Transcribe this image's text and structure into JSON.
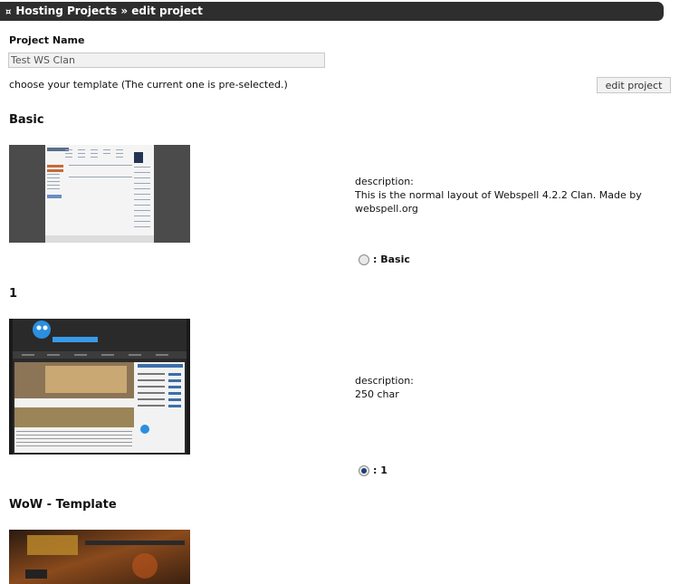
{
  "header": {
    "icon": "hosting-icon",
    "title": "Hosting Projects » edit project"
  },
  "form": {
    "project_name_label": "Project Name",
    "project_name_value": "Test WS Clan",
    "template_hint": "choose your template (The current one is pre-selected.)",
    "submit_label": "edit project"
  },
  "templates": [
    {
      "name": "Basic",
      "description_label": "description:",
      "description": "This is the normal layout of Webspell 4.2.2 Clan. Made by webspell.org",
      "radio_label": ": Basic",
      "selected": false
    },
    {
      "name": "1",
      "description_label": "description:",
      "description": "250 char",
      "radio_label": ": 1",
      "selected": true
    },
    {
      "name": "WoW - Template",
      "selected": false
    }
  ],
  "colors": {
    "header_bg": "#2e2e2e",
    "radio_selected": "#1d3d78"
  }
}
